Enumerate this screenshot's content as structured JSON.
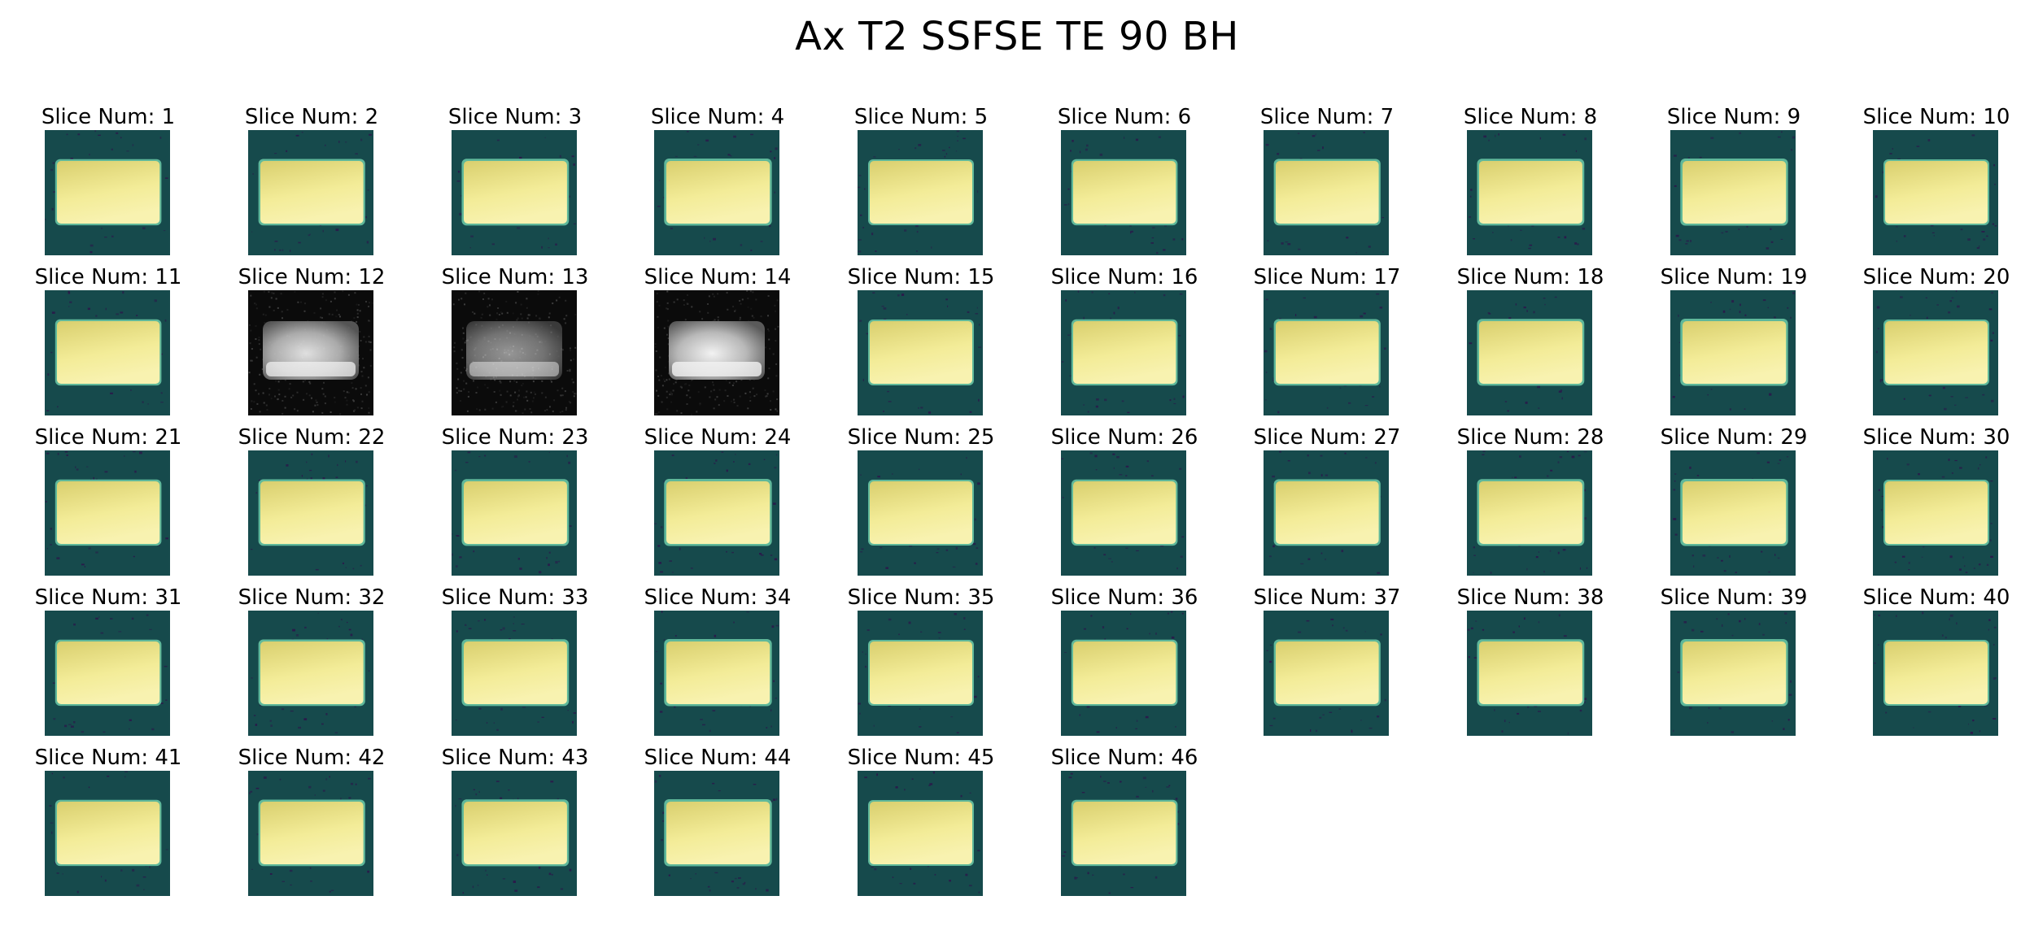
{
  "figure": {
    "title": "Ax T2 SSFSE TE 90 BH",
    "grid_columns": 10,
    "grid_rows": 5
  },
  "colors": {
    "background": "#ffffff",
    "viridis_background": "#164a4c",
    "viridis_speckle": "#2a1a4a",
    "viridis_phantom_edge": "#5fb89a",
    "viridis_phantom_bright": "#f3ec98",
    "viridis_phantom_mid": "#d9cf6e",
    "gray_background": "#0b0b0b",
    "gray_phantom_bright": "#f2f2f2"
  },
  "slices": [
    {
      "label": "Slice Num: 1",
      "num": 1,
      "colormap": "viridis"
    },
    {
      "label": "Slice Num: 2",
      "num": 2,
      "colormap": "viridis"
    },
    {
      "label": "Slice Num: 3",
      "num": 3,
      "colormap": "viridis"
    },
    {
      "label": "Slice Num: 4",
      "num": 4,
      "colormap": "viridis"
    },
    {
      "label": "Slice Num: 5",
      "num": 5,
      "colormap": "viridis"
    },
    {
      "label": "Slice Num: 6",
      "num": 6,
      "colormap": "viridis"
    },
    {
      "label": "Slice Num: 7",
      "num": 7,
      "colormap": "viridis"
    },
    {
      "label": "Slice Num: 8",
      "num": 8,
      "colormap": "viridis"
    },
    {
      "label": "Slice Num: 9",
      "num": 9,
      "colormap": "viridis"
    },
    {
      "label": "Slice Num: 10",
      "num": 10,
      "colormap": "viridis"
    },
    {
      "label": "Slice Num: 11",
      "num": 11,
      "colormap": "viridis"
    },
    {
      "label": "Slice Num: 12",
      "num": 12,
      "colormap": "gray"
    },
    {
      "label": "Slice Num: 13",
      "num": 13,
      "colormap": "gray"
    },
    {
      "label": "Slice Num: 14",
      "num": 14,
      "colormap": "gray"
    },
    {
      "label": "Slice Num: 15",
      "num": 15,
      "colormap": "viridis"
    },
    {
      "label": "Slice Num: 16",
      "num": 16,
      "colormap": "viridis"
    },
    {
      "label": "Slice Num: 17",
      "num": 17,
      "colormap": "viridis"
    },
    {
      "label": "Slice Num: 18",
      "num": 18,
      "colormap": "viridis"
    },
    {
      "label": "Slice Num: 19",
      "num": 19,
      "colormap": "viridis"
    },
    {
      "label": "Slice Num: 20",
      "num": 20,
      "colormap": "viridis"
    },
    {
      "label": "Slice Num: 21",
      "num": 21,
      "colormap": "viridis"
    },
    {
      "label": "Slice Num: 22",
      "num": 22,
      "colormap": "viridis"
    },
    {
      "label": "Slice Num: 23",
      "num": 23,
      "colormap": "viridis"
    },
    {
      "label": "Slice Num: 24",
      "num": 24,
      "colormap": "viridis"
    },
    {
      "label": "Slice Num: 25",
      "num": 25,
      "colormap": "viridis"
    },
    {
      "label": "Slice Num: 26",
      "num": 26,
      "colormap": "viridis"
    },
    {
      "label": "Slice Num: 27",
      "num": 27,
      "colormap": "viridis"
    },
    {
      "label": "Slice Num: 28",
      "num": 28,
      "colormap": "viridis"
    },
    {
      "label": "Slice Num: 29",
      "num": 29,
      "colormap": "viridis"
    },
    {
      "label": "Slice Num: 30",
      "num": 30,
      "colormap": "viridis"
    },
    {
      "label": "Slice Num: 31",
      "num": 31,
      "colormap": "viridis"
    },
    {
      "label": "Slice Num: 32",
      "num": 32,
      "colormap": "viridis"
    },
    {
      "label": "Slice Num: 33",
      "num": 33,
      "colormap": "viridis"
    },
    {
      "label": "Slice Num: 34",
      "num": 34,
      "colormap": "viridis"
    },
    {
      "label": "Slice Num: 35",
      "num": 35,
      "colormap": "viridis"
    },
    {
      "label": "Slice Num: 36",
      "num": 36,
      "colormap": "viridis"
    },
    {
      "label": "Slice Num: 37",
      "num": 37,
      "colormap": "viridis"
    },
    {
      "label": "Slice Num: 38",
      "num": 38,
      "colormap": "viridis"
    },
    {
      "label": "Slice Num: 39",
      "num": 39,
      "colormap": "viridis"
    },
    {
      "label": "Slice Num: 40",
      "num": 40,
      "colormap": "viridis"
    },
    {
      "label": "Slice Num: 41",
      "num": 41,
      "colormap": "viridis"
    },
    {
      "label": "Slice Num: 42",
      "num": 42,
      "colormap": "viridis"
    },
    {
      "label": "Slice Num: 43",
      "num": 43,
      "colormap": "viridis"
    },
    {
      "label": "Slice Num: 44",
      "num": 44,
      "colormap": "viridis"
    },
    {
      "label": "Slice Num: 45",
      "num": 45,
      "colormap": "viridis"
    },
    {
      "label": "Slice Num: 46",
      "num": 46,
      "colormap": "viridis"
    }
  ]
}
